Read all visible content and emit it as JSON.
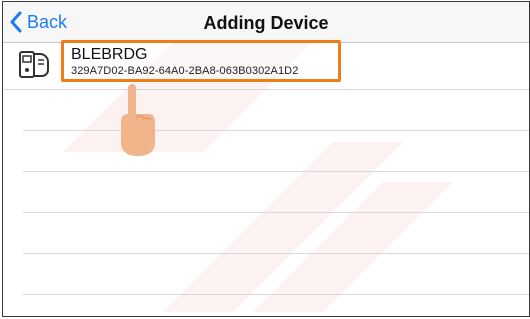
{
  "navbar": {
    "back_label": "Back",
    "title": "Adding Device"
  },
  "devices": [
    {
      "name": "BLEBRDG",
      "uuid": "329A7D02-BA92-64A0-2BA8-063B0302A1D2",
      "icon": "ble-device-icon"
    }
  ],
  "colors": {
    "accent": "#1c7cf6",
    "highlight_border": "#ef7d1a",
    "watermark": "#e84c4c"
  },
  "annotation": {
    "icon": "tap-hand-icon"
  }
}
